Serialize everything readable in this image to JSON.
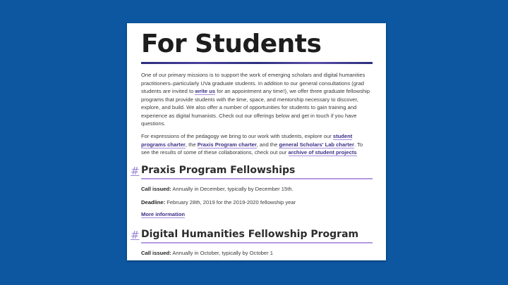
{
  "page": {
    "title": "For Students",
    "intro": {
      "t1": "One of our primary missions is to support the work of emerging scholars and digital humanities practitioners–particularly UVa graduate students. In addition to our general consultations (grad students are invited to ",
      "link_write_us": "write us",
      "t2": " for an appointment any time!), we offer three graduate fellowship programs that provide students with the time, space, and mentorship necessary to discover, explore, and build. We also offer a number of opportunities for students to gain training and experience as digital humanists. Check out our offerings below and get in touch if you have questions."
    },
    "pedagogy": {
      "t1": "For expressions of the pedagogy we bring to our work with students, explore our ",
      "link_student_charter": "student programs charter",
      "t2": ", the ",
      "link_praxis_charter": "Praxis Program charter",
      "t3": ", and the ",
      "link_general_charter": "general Scholars' Lab charter",
      "t4": ". To see the results of some of these collaborations, check out our ",
      "link_archive": "archive of student projects"
    },
    "sections": [
      {
        "hash": "#",
        "title": "Praxis Program Fellowships",
        "call_label": "Call issued:",
        "call_value": " Annually in December, typically by December 15th.",
        "deadline_label": "Deadline:",
        "deadline_value": " February 28th, 2019 for the 2019-2020 fellowship year",
        "more": "More information"
      },
      {
        "hash": "#",
        "title": "Digital Humanities Fellowship Program",
        "call_label": "Call issued:",
        "call_value": " Annually in October, typically by October 1"
      }
    ]
  },
  "colors": {
    "background": "#0c57a0",
    "link": "#3b2f86",
    "underline": "#a78bdf"
  }
}
